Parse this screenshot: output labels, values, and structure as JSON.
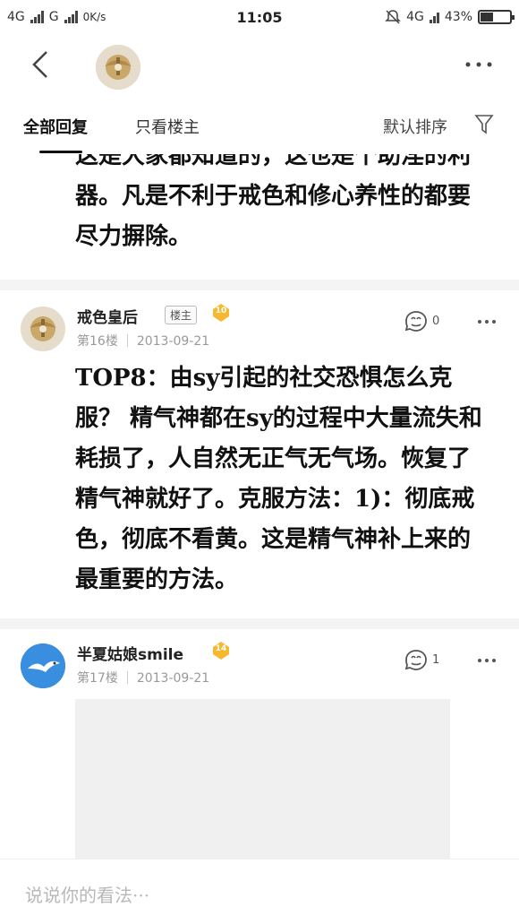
{
  "status_bar": {
    "network1": "4G",
    "network2": "G",
    "speed": "0K/s",
    "time": "11:05",
    "network3": "4G",
    "battery": "43%",
    "battery_level": 0.43
  },
  "tabs": {
    "all_replies": "全部回复",
    "owner_only": "只看楼主",
    "sort": "默认排序"
  },
  "previous_post_text": "这是大家都知道的，这也是个助淫的利器。凡是不利于戒色和修心养性的都要尽力摒除。",
  "floors": [
    {
      "author": "戒色皇后",
      "owner_badge": "楼主",
      "level": "10",
      "floor": "第16楼",
      "date": "2013-09-21",
      "likes": "0",
      "text": "TOP8：由sy引起的社交恐惧怎么克服？ 精气神都在sy的过程中大量流失和耗损了，人自然无正气无气场。恢复了精气神就好了。克服方法：1)：彻底戒色，彻底不看黄。这是精气神补上来的最重要的方法。"
    },
    {
      "author": "半夏姑娘smile",
      "level": "14",
      "floor": "第17楼",
      "date": "2013-09-21",
      "likes": "1"
    }
  ],
  "comment_input": {
    "placeholder": "说说你的看法···"
  },
  "colors": {
    "level_badge": "#f5b82e",
    "text": "#111111",
    "muted": "#999999"
  }
}
